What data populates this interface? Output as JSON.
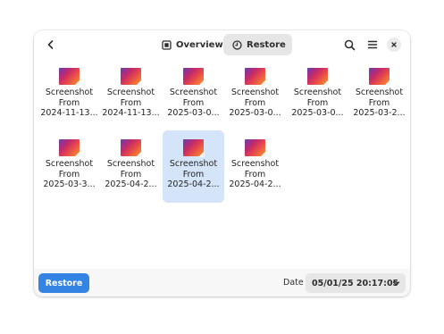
{
  "header": {
    "tabs": [
      {
        "label": "Overview",
        "icon": "overview-icon",
        "active": false
      },
      {
        "label": "Restore",
        "icon": "clock-icon",
        "active": true
      }
    ],
    "buttons": {
      "back": "back-arrow-icon",
      "search": "search-icon",
      "menu": "hamburger-menu-icon",
      "close": "close-icon"
    }
  },
  "files": [
    {
      "line1": "Screenshot",
      "line2": "From",
      "line3": "2024-11-13...",
      "selected": false
    },
    {
      "line1": "Screenshot",
      "line2": "From",
      "line3": "2024-11-13...",
      "selected": false
    },
    {
      "line1": "Screenshot",
      "line2": "From",
      "line3": "2025-03-0...",
      "selected": false
    },
    {
      "line1": "Screenshot",
      "line2": "From",
      "line3": "2025-03-0...",
      "selected": false
    },
    {
      "line1": "Screenshot",
      "line2": "From",
      "line3": "2025-03-0...",
      "selected": false
    },
    {
      "line1": "Screenshot",
      "line2": "From",
      "line3": "2025-03-2...",
      "selected": false
    },
    {
      "line1": "Screenshot",
      "line2": "From",
      "line3": "2025-03-3...",
      "selected": false
    },
    {
      "line1": "Screenshot",
      "line2": "From",
      "line3": "2025-04-2...",
      "selected": false
    },
    {
      "line1": "Screenshot",
      "line2": "From",
      "line3": "2025-04-2...",
      "selected": true
    },
    {
      "line1": "Screenshot",
      "line2": "From",
      "line3": "2025-04-2...",
      "selected": false
    }
  ],
  "footer": {
    "restore_label": "Restore",
    "date_label": "Date",
    "date_value": "05/01/25 20:17:05"
  },
  "colors": {
    "accent": "#3584e4",
    "selection": "#d4e4f9",
    "tab_active_bg": "#e6e6e6"
  }
}
